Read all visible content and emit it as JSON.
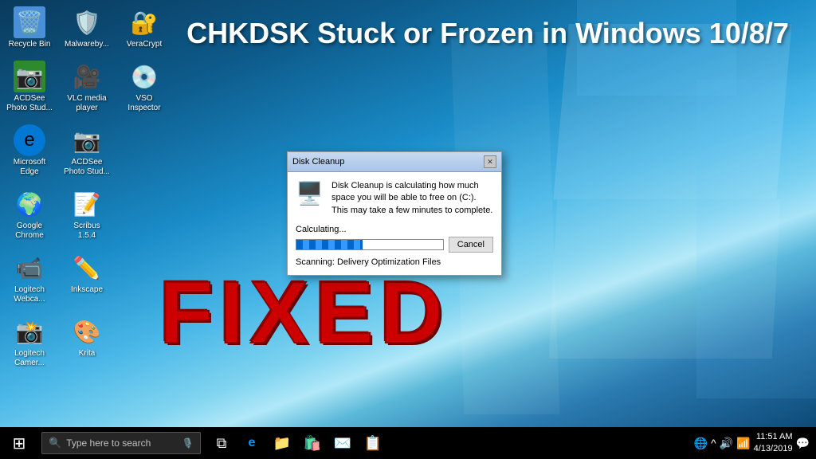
{
  "desktop": {
    "background": "windows10-blue",
    "title": "CHKDSK Stuck or Frozen in Windows 10/8/7",
    "fixed_label": "FIXED"
  },
  "icons": {
    "row1": [
      {
        "id": "recycle-bin",
        "label": "Recycle Bin",
        "emoji": "🗑️"
      },
      {
        "id": "malwarebytes",
        "label": "Malwareby...",
        "emoji": "🛡️"
      },
      {
        "id": "veracrypt",
        "label": "VeraCrypt",
        "emoji": "🔐"
      }
    ],
    "row2": [
      {
        "id": "acdsee",
        "label": "ACDSee Photo Stud...",
        "emoji": "📷"
      },
      {
        "id": "vlc",
        "label": "VLC media player",
        "emoji": "🎥"
      },
      {
        "id": "vso",
        "label": "VSO Inspector",
        "emoji": "💿"
      }
    ],
    "row3": [
      {
        "id": "edge",
        "label": "Microsoft Edge",
        "emoji": "🌐"
      },
      {
        "id": "acdsee2",
        "label": "ACDSee Photo Stud...",
        "emoji": "📷"
      }
    ],
    "row4": [
      {
        "id": "chrome",
        "label": "Google Chrome",
        "emoji": "🌍"
      },
      {
        "id": "scribus",
        "label": "Scribus 1.5.4",
        "emoji": "📝"
      }
    ],
    "row5": [
      {
        "id": "logitech",
        "label": "Logitech Webca...",
        "emoji": "📹"
      },
      {
        "id": "inkscape",
        "label": "Inkscape",
        "emoji": "✏️"
      }
    ],
    "row6": [
      {
        "id": "logitech2",
        "label": "Logitech Camer...",
        "emoji": "📸"
      },
      {
        "id": "krita",
        "label": "Krita",
        "emoji": "🎨"
      }
    ]
  },
  "dialog": {
    "title": "Disk Cleanup",
    "message": "Disk Cleanup is calculating how much space you will be able to free on  (C:). This may take a few minutes to complete.",
    "calculating_label": "Calculating...",
    "cancel_button": "Cancel",
    "scanning_label": "Scanning:  Delivery Optimization Files",
    "progress_percent": 45
  },
  "taskbar": {
    "search_placeholder": "Type here to search",
    "time": "11:51 AM",
    "date": "4/13/2019",
    "icons": [
      "⊞",
      "🌐",
      "📁",
      "🛍️",
      "✉️",
      "📋"
    ]
  }
}
